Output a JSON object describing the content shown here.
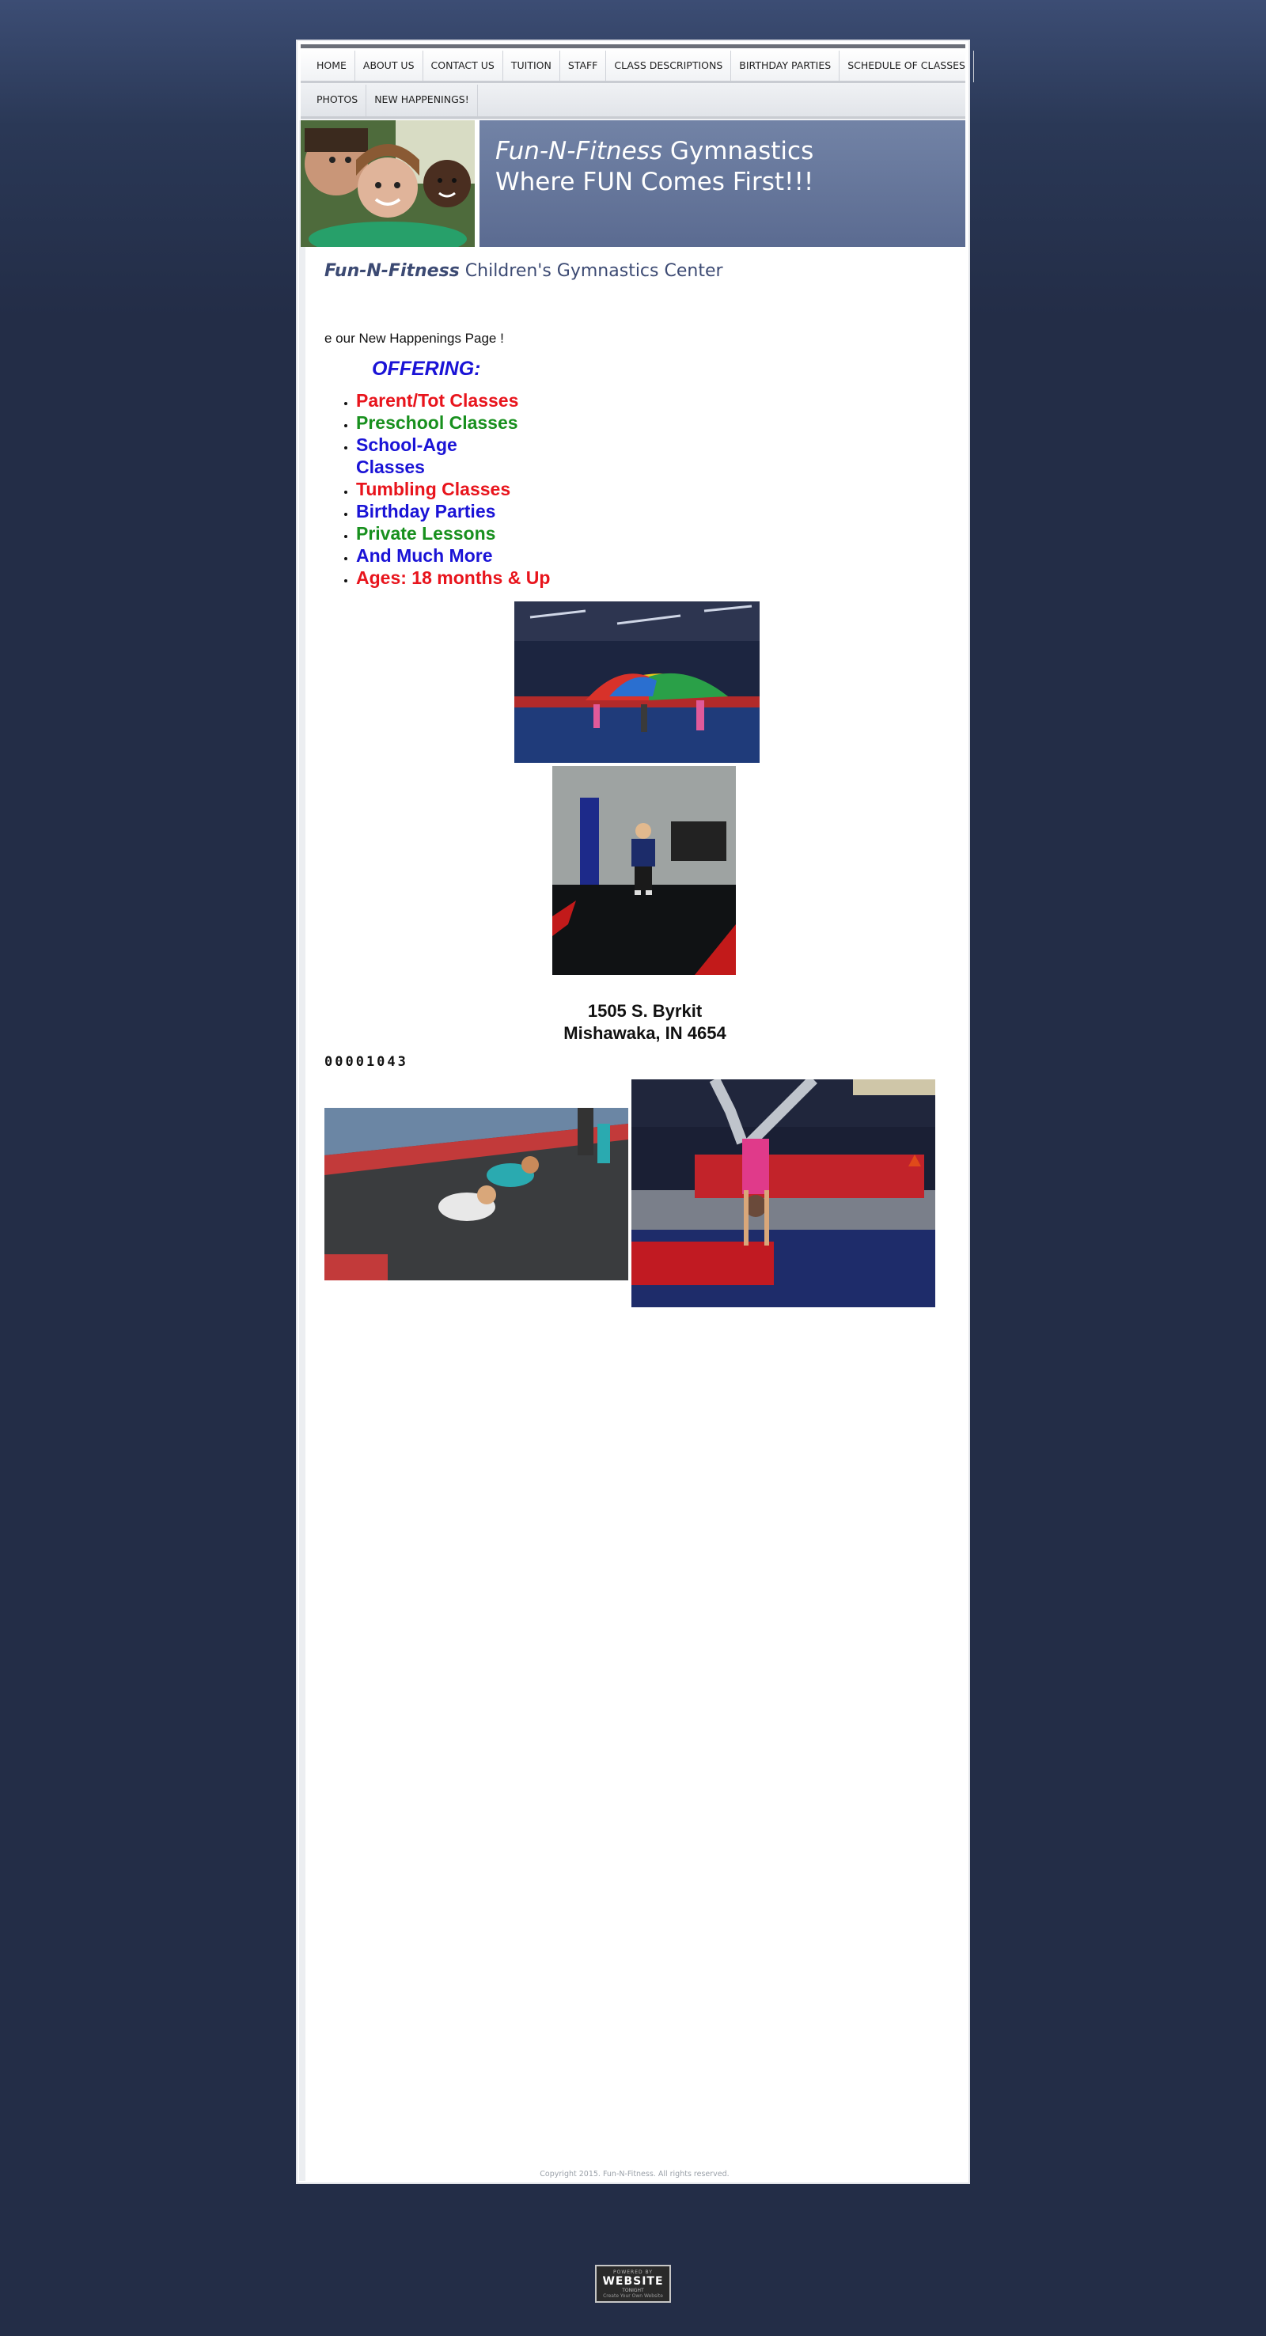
{
  "nav": {
    "row1": [
      "HOME",
      "ABOUT US",
      "CONTACT US",
      "TUITION",
      "STAFF",
      "CLASS DESCRIPTIONS",
      "BIRTHDAY PARTIES",
      "SCHEDULE OF CLASSES"
    ],
    "row2": [
      "PHOTOS",
      "NEW HAPPENINGS!"
    ]
  },
  "banner": {
    "brand": "Fun-N-Fitness",
    "brand_suffix": " Gymnastics",
    "tagline": "Where FUN Comes First!!!"
  },
  "subheading": {
    "brand": "Fun-N-Fitness",
    "rest": " Children's Gymnastics Center"
  },
  "news_line": "e our New Happenings Page !",
  "offering": {
    "heading": "OFFERING:",
    "items": [
      {
        "label": "Parent/Tot Classes",
        "color": "#e8141c"
      },
      {
        "label": "Preschool Classes",
        "color": "#18901e"
      },
      {
        "label": "School-Age Classes",
        "color": "#1a13d6"
      },
      {
        "label": "Tumbling Classes",
        "color": "#e8141c"
      },
      {
        "label": "Birthday Parties",
        "color": "#1a13d6"
      },
      {
        "label": "Private Lessons",
        "color": "#18901e"
      },
      {
        "label": "And Much More",
        "color": "#1a13d6"
      },
      {
        "label": "Ages: 18 months & Up",
        "color": "#e8141c"
      }
    ]
  },
  "address": {
    "line1": "1505 S. Byrkit",
    "line2": "Mishawaka, IN  4654"
  },
  "counter": "00001043",
  "footer": {
    "copyright": "Copyright 2015. Fun-N-Fitness. All rights reserved."
  },
  "badge": {
    "top": "POWERED BY",
    "main": "WEBSITE",
    "sub": "TONIGHT",
    "bottom": "Create Your Own Website"
  }
}
